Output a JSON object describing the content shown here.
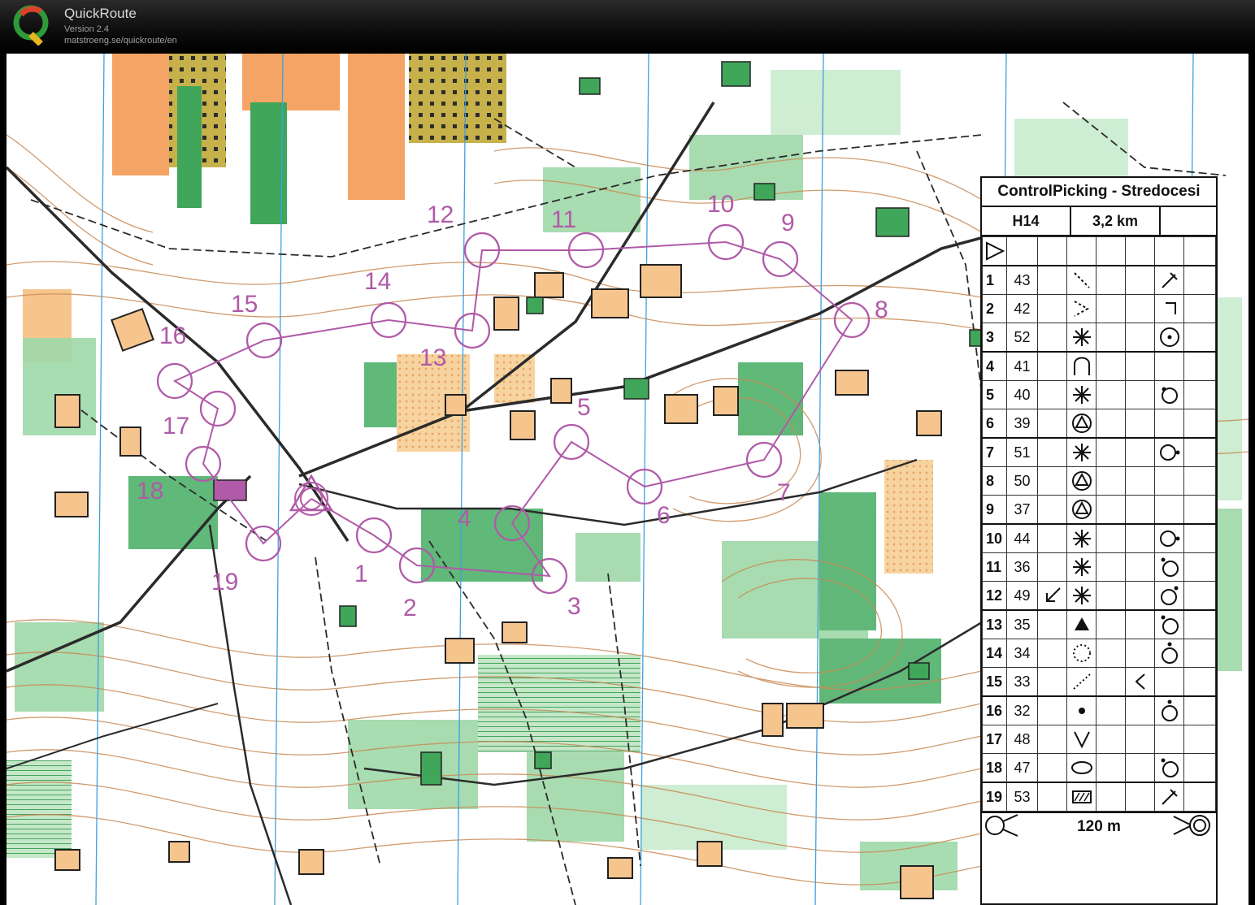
{
  "app": {
    "name": "QuickRoute",
    "version": "Version 2.4",
    "url": "matstroeng.se/quickroute/en"
  },
  "colors": {
    "course": "#b05aa8",
    "contour": "#c98a55",
    "forest_green": "#3fa65a",
    "light_green": "#9fd8a8",
    "open_orange": "#f4a465",
    "rough_open": "#f6d09b",
    "north_line": "#3ea0e0",
    "road": "#2b2b2b"
  },
  "course_labels": [
    "1",
    "2",
    "3",
    "4",
    "5",
    "6",
    "7",
    "8",
    "9",
    "10",
    "11",
    "12",
    "13",
    "14",
    "15",
    "16",
    "17",
    "18",
    "19"
  ],
  "description": {
    "title": "ControlPicking - Stredocesi",
    "class": "H14",
    "length": "3,2 km",
    "controls": [
      {
        "num": "1",
        "code": "43",
        "feature": "vague-line-icon",
        "detail": "angle-icon"
      },
      {
        "num": "2",
        "code": "42",
        "feature": "v-dots-icon",
        "detail": "corner-icon"
      },
      {
        "num": "3",
        "code": "52",
        "feature": "thicket-icon",
        "detail": "circle-dot-icon"
      },
      {
        "num": "4",
        "code": "41",
        "feature": "knoll-spur-icon",
        "detail": ""
      },
      {
        "num": "5",
        "code": "40",
        "feature": "thicket-icon",
        "detail": "circle-lower-left-icon"
      },
      {
        "num": "6",
        "code": "39",
        "feature": "triangle-circle-icon",
        "detail": ""
      },
      {
        "num": "7",
        "code": "51",
        "feature": "thicket-icon",
        "detail": "circle-right-icon"
      },
      {
        "num": "8",
        "code": "50",
        "feature": "triangle-circle-icon",
        "detail": ""
      },
      {
        "num": "9",
        "code": "37",
        "feature": "triangle-circle-icon",
        "detail": ""
      },
      {
        "num": "10",
        "code": "44",
        "feature": "thicket-icon",
        "detail": "circle-right-icon"
      },
      {
        "num": "11",
        "code": "36",
        "feature": "thicket-icon",
        "detail": "circle-upper-left-icon"
      },
      {
        "num": "12",
        "code": "49",
        "feature": "thicket-icon",
        "detail": "circle-upper-right-icon",
        "direction": "arrow-southwest-icon"
      },
      {
        "num": "13",
        "code": "35",
        "feature": "filled-triangle-icon",
        "detail": "circle-upper-left-icon"
      },
      {
        "num": "14",
        "code": "34",
        "feature": "dotted-circle-icon",
        "detail": "circle-top-icon"
      },
      {
        "num": "15",
        "code": "33",
        "feature": "dotted-line-icon",
        "detail": "bend-left-icon",
        "extra": true
      },
      {
        "num": "16",
        "code": "32",
        "feature": "dot-icon",
        "detail": "circle-top-icon"
      },
      {
        "num": "17",
        "code": "48",
        "feature": "v-icon",
        "detail": ""
      },
      {
        "num": "18",
        "code": "47",
        "feature": "ellipse-icon",
        "detail": "circle-upper-left-icon"
      },
      {
        "num": "19",
        "code": "53",
        "feature": "hatched-rect-icon",
        "detail": "angle-icon"
      }
    ],
    "finish_distance": "120 m"
  }
}
